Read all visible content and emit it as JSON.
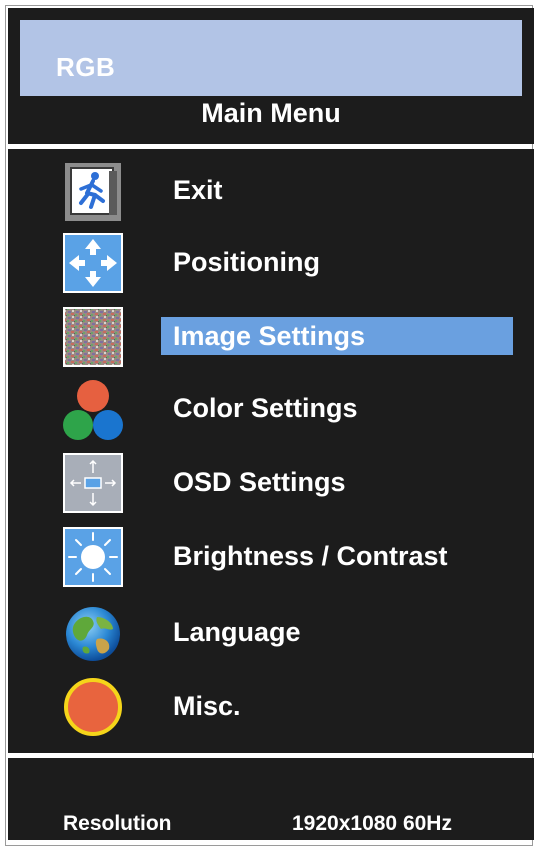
{
  "osd": {
    "input_source": "RGB",
    "title": "Main Menu",
    "selected_item": "Image Settings",
    "items": [
      {
        "label": "Exit",
        "icon": "exit-icon"
      },
      {
        "label": "Positioning",
        "icon": "positioning-arrows-icon"
      },
      {
        "label": "Image Settings",
        "icon": "image-noise-icon"
      },
      {
        "label": "Color Settings",
        "icon": "rgb-circles-icon"
      },
      {
        "label": "OSD Settings",
        "icon": "osd-position-icon"
      },
      {
        "label": "Brightness / Contrast",
        "icon": "sun-icon"
      },
      {
        "label": "Language",
        "icon": "globe-icon"
      },
      {
        "label": "Misc.",
        "icon": "misc-circle-icon"
      }
    ],
    "footer": {
      "resolution_label": "Resolution",
      "resolution_value": "1920x1080 60Hz"
    }
  },
  "colors": {
    "panel_background": "#1c1c1c",
    "source_bar": "#b2c4e6",
    "selection_highlight": "#6aa0e0",
    "text": "#ffffff"
  }
}
